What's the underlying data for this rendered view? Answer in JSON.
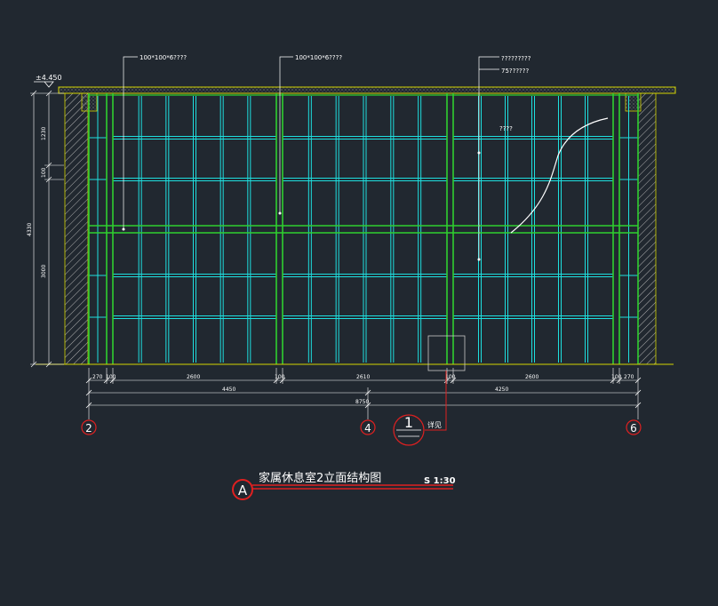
{
  "drawing": {
    "elevation_mark": "±4.450",
    "callouts": {
      "left": "100*100*6????",
      "center": "100*100*6????",
      "right_1": "?????????",
      "right_2": "75??????",
      "curve_note": "????"
    },
    "dimensions": {
      "bottom_row1": [
        "270",
        "100",
        "2600",
        "100",
        "2610",
        "100",
        "2600",
        "100",
        "270"
      ],
      "bottom_row2": [
        "4450",
        "4250"
      ],
      "bottom_total": "8750",
      "left_heights": [
        "1230",
        "100",
        "3000"
      ],
      "left_total": "4330"
    },
    "axis_labels": [
      "2",
      "4",
      "6"
    ],
    "detail": {
      "number": "1",
      "note": "详见"
    },
    "title": {
      "badge": "A",
      "text": "家属休息室2立面结构图",
      "scale": "S 1:30"
    }
  },
  "colors": {
    "background": "#212830",
    "frame": "#2fcf2f",
    "glass_grid": "#1ee0e0",
    "hatch": "#c8c8c8",
    "beam": "#d4d400",
    "axis_circle": "#e02020",
    "dimension": "#ffffff"
  }
}
